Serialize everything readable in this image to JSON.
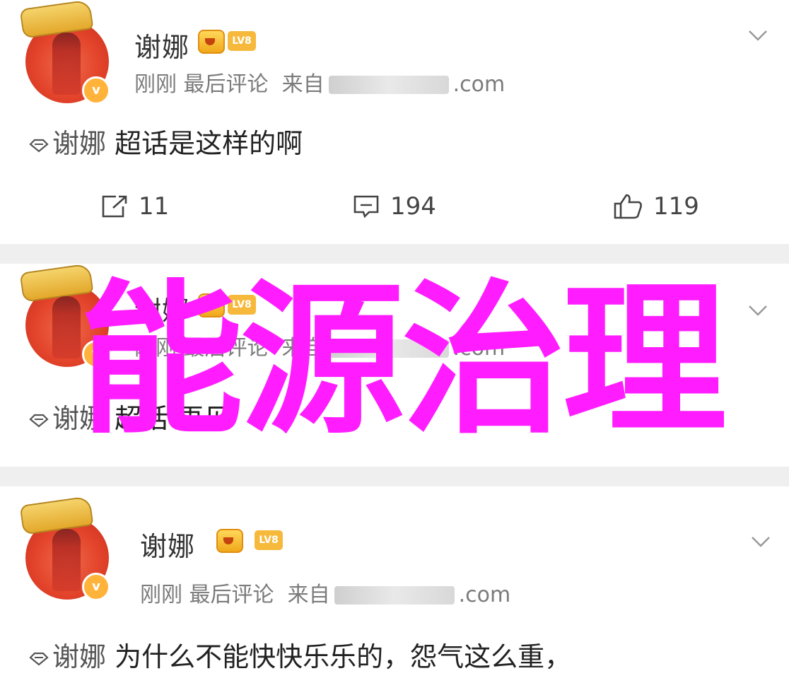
{
  "posts": [
    {
      "username": "谢娜",
      "level_badge": "LV8",
      "time": "刚刚",
      "activity": "最后评论",
      "source_prefix": "来自",
      "source_suffix": ".com",
      "topic": "谢娜",
      "text": "超话是这样的啊",
      "share_count": "11",
      "comment_count": "194",
      "like_count": "119"
    },
    {
      "username": "谢娜",
      "level_badge": "LV8",
      "time": "刚刚",
      "activity": "最后评论",
      "source_prefix": "来自",
      "source_suffix": ".com",
      "topic": "谢娜",
      "text": "超话 再见"
    },
    {
      "username": "谢娜",
      "level_badge": "LV8",
      "time": "刚刚",
      "activity": "最后评论",
      "source_prefix": "来自",
      "source_suffix": ".com",
      "topic": "谢娜",
      "text": "为什么不能快快乐乐的，怨气这么重，"
    }
  ],
  "overlay": {
    "title": "能源治理",
    "color": "#ff1dff"
  },
  "colors": {
    "divider": "#efefef",
    "meta": "#7b7b7b",
    "badge": "#f6b93b"
  }
}
